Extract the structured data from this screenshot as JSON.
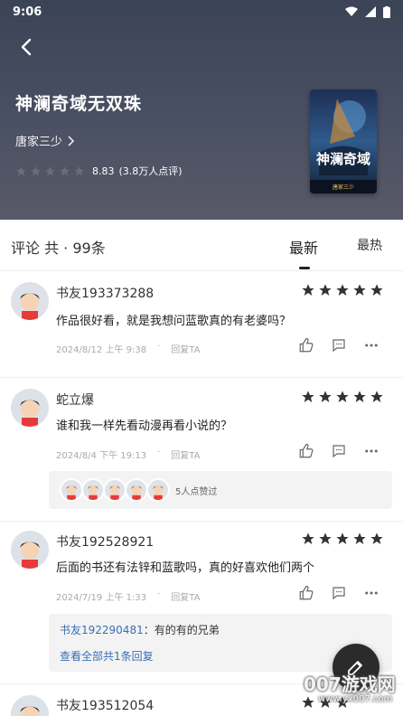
{
  "status": {
    "time": "9:06"
  },
  "book": {
    "title": "神澜奇域无双珠",
    "author": "唐家三少",
    "score": "8.83",
    "rating_count": "(3.8万人点评)",
    "cover_text": "神澜奇域",
    "cover_author": "唐家三少"
  },
  "comments_header": {
    "title": "评论 共 · 99条",
    "tab_latest": "最新",
    "tab_hot": "最热"
  },
  "comments": [
    {
      "name": "书友193373288",
      "text": "作品很好看，就是我想问蓝歌真的有老婆吗？",
      "date": "2024/8/12 上午 9:38",
      "reply": "回复TA",
      "stars": 5
    },
    {
      "name": "蛇立爆",
      "text": "谁和我一样先看动漫再看小说的？",
      "date": "2024/8/4 下午 19:13",
      "reply": "回复TA",
      "stars": 5,
      "likes_text": "5人点赞过"
    },
    {
      "name": "书友192528921",
      "text": "后面的书还有法锌和蓝歌吗，真的好喜欢他们两个",
      "date": "2024/7/19 上午 1:33",
      "reply": "回复TA",
      "stars": 5,
      "sub_reply": {
        "user": "书友192290481",
        "text": "：有的有的兄弟",
        "more": "查看全部共1条回复"
      }
    },
    {
      "name": "书友193512054",
      "stars": 5
    }
  ],
  "watermark": {
    "title": "007游戏网",
    "url": "www.yx007.com"
  },
  "colors": {
    "accent_link": "#3b6fb4",
    "hero_bg": "#4a5063"
  }
}
